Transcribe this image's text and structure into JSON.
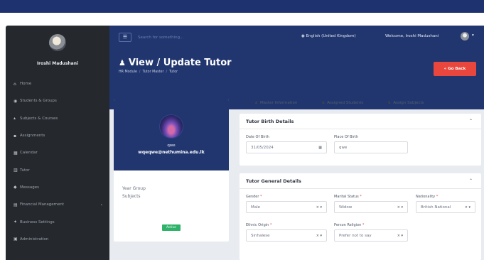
{
  "sidebar": {
    "user_name": "Iroshi Madushani",
    "items": [
      {
        "label": "Home",
        "icon": "home-icon",
        "glyph": "⌂"
      },
      {
        "label": "Students & Groups",
        "icon": "students-icon",
        "glyph": "◉"
      },
      {
        "label": "Subjects & Courses",
        "icon": "graduation-cap-icon",
        "glyph": "▴"
      },
      {
        "label": "Assignments",
        "icon": "assignment-icon",
        "glyph": "▪"
      },
      {
        "label": "Calendar",
        "icon": "calendar-icon",
        "glyph": "▦"
      },
      {
        "label": "Tutor",
        "icon": "tutor-icon",
        "glyph": "▥"
      },
      {
        "label": "Messages",
        "icon": "message-icon",
        "glyph": "◆"
      },
      {
        "label": "Financial Management",
        "icon": "finance-icon",
        "glyph": "▤",
        "chevron": "‹"
      },
      {
        "label": "Business Settings",
        "icon": "settings-icon",
        "glyph": "✦"
      },
      {
        "label": "Administration",
        "icon": "admin-icon",
        "glyph": "▣"
      }
    ]
  },
  "header": {
    "menu_glyph": "☰",
    "search_placeholder": "Search for something...",
    "language": "English (United Kingdom)",
    "welcome": "Welcome, Iroshi Madushani",
    "caret": "▾"
  },
  "page": {
    "title": "View / Update Tutor",
    "title_icon": "♟",
    "breadcrumb": [
      "HR Module",
      "Tutor Master",
      "Tutor"
    ],
    "breadcrumb_sep": "/",
    "go_back_label": "« Go Back"
  },
  "profile": {
    "name": "qwe",
    "email": "wqeqwe@nethumina.edu.lk",
    "year_group_label": "Year Group",
    "subjects_label": "Subjects",
    "status": "Active"
  },
  "tabs": {
    "prev": "‹",
    "next": "›",
    "items": [
      {
        "label": "Master Information",
        "glyph": "♟"
      },
      {
        "label": "Assigned Students",
        "glyph": "♞"
      },
      {
        "label": "Assign Subjects",
        "glyph": "♞"
      }
    ]
  },
  "birth": {
    "title": "Tutor Birth Details",
    "caret": "⌃",
    "dob_label": "Date Of Birth",
    "dob_value": "31/05/2024",
    "dob_icon": "▦",
    "pob_label": "Place Of Birth",
    "pob_value": "qwe"
  },
  "general": {
    "title": "Tutor General Details",
    "caret": "⌃",
    "required_mark": "*",
    "select_suffix": "× ▾",
    "gender_label": "Gender",
    "gender_value": "Male",
    "marital_label": "Marital Status",
    "marital_value": "Widow",
    "nationality_label": "Nationality",
    "nationality_value": "British National",
    "ethnic_label": "Ethnic Origin",
    "ethnic_value": "Sinhalese",
    "religion_label": "Person Religion",
    "religion_value": "Prefer not to say"
  },
  "colors": {
    "navy": "#21366f",
    "sidebar": "#25292e",
    "accent_red": "#e9473d",
    "active_green": "#2fb36a"
  }
}
